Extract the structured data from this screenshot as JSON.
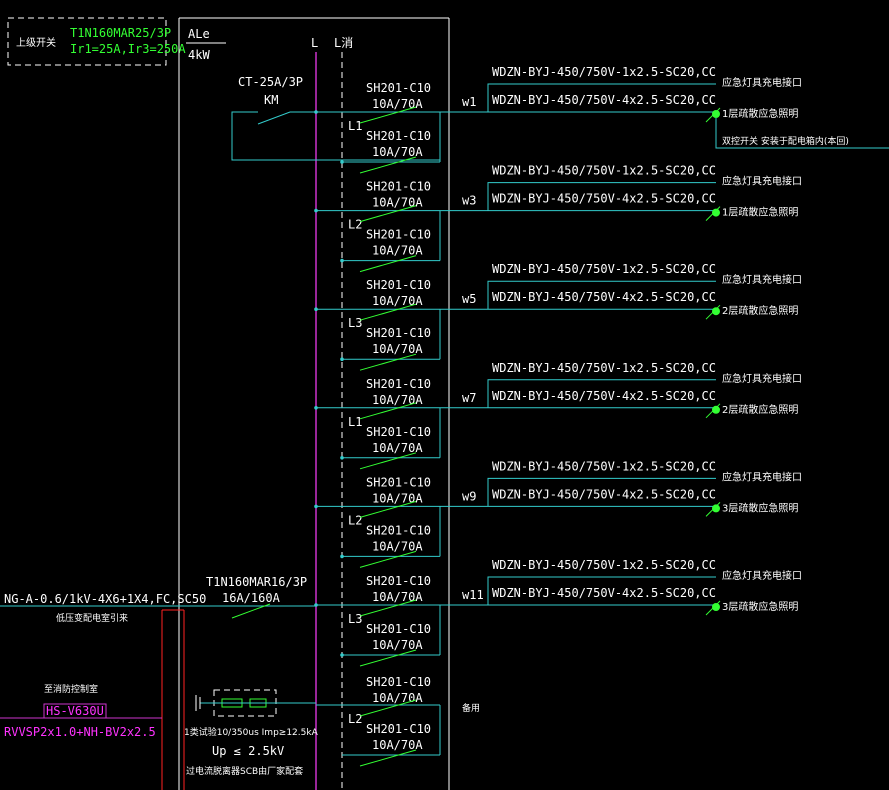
{
  "upstream": {
    "label": "上级开关",
    "breaker_model": "T1N160MAR25/3P",
    "breaker_setting": "Ir1=25A,Ir3=250A"
  },
  "panel": {
    "name": "ALe",
    "power": "4kW",
    "bus_l": "L",
    "bus_fire": "L消"
  },
  "contactor": {
    "model": "CT-25A/3P",
    "tag": "KM"
  },
  "main_breaker": {
    "model": "T1N160MAR16/3P",
    "rating": "16A/160A"
  },
  "incoming": {
    "cable": "NG-A-0.6/1kV-4X6+1X4,FC,SC50",
    "source": "低压变配电室引来"
  },
  "fire_control": {
    "room": "至消防控制室",
    "module": "HS-V630U",
    "cable": "RVVSP2x1.0+NH-BV2x2.5"
  },
  "spd": {
    "spec": "1类试验10/350us Imp≥12.5kA",
    "up": "Up ≤ 2.5kV",
    "note": "过电流脱离器SCB由厂家配套"
  },
  "circuits": [
    {
      "phase": "L1",
      "breaker_a": "SH201-C10",
      "rating_a": "10A/70A",
      "breaker_b": "SH201-C10",
      "rating_b": "10A/70A",
      "id": "w1",
      "cable_a": "WDZN-BYJ-450/750V-1x2.5-SC20,CC",
      "cable_b": "WDZN-BYJ-450/750V-4x2.5-SC20,CC",
      "dest_a": "应急灯具充电接口",
      "dest_b": "1层疏散应急照明",
      "note": "双控开关 安装于配电箱内(本回)"
    },
    {
      "phase": "L2",
      "breaker_a": "SH201-C10",
      "rating_a": "10A/70A",
      "breaker_b": "SH201-C10",
      "rating_b": "10A/70A",
      "id": "w3",
      "cable_a": "WDZN-BYJ-450/750V-1x2.5-SC20,CC",
      "cable_b": "WDZN-BYJ-450/750V-4x2.5-SC20,CC",
      "dest_a": "应急灯具充电接口",
      "dest_b": "1层疏散应急照明",
      "note": ""
    },
    {
      "phase": "L3",
      "breaker_a": "SH201-C10",
      "rating_a": "10A/70A",
      "breaker_b": "SH201-C10",
      "rating_b": "10A/70A",
      "id": "w5",
      "cable_a": "WDZN-BYJ-450/750V-1x2.5-SC20,CC",
      "cable_b": "WDZN-BYJ-450/750V-4x2.5-SC20,CC",
      "dest_a": "应急灯具充电接口",
      "dest_b": "2层疏散应急照明",
      "note": ""
    },
    {
      "phase": "L1",
      "breaker_a": "SH201-C10",
      "rating_a": "10A/70A",
      "breaker_b": "SH201-C10",
      "rating_b": "10A/70A",
      "id": "w7",
      "cable_a": "WDZN-BYJ-450/750V-1x2.5-SC20,CC",
      "cable_b": "WDZN-BYJ-450/750V-4x2.5-SC20,CC",
      "dest_a": "应急灯具充电接口",
      "dest_b": "2层疏散应急照明",
      "note": ""
    },
    {
      "phase": "L2",
      "breaker_a": "SH201-C10",
      "rating_a": "10A/70A",
      "breaker_b": "SH201-C10",
      "rating_b": "10A/70A",
      "id": "w9",
      "cable_a": "WDZN-BYJ-450/750V-1x2.5-SC20,CC",
      "cable_b": "WDZN-BYJ-450/750V-4x2.5-SC20,CC",
      "dest_a": "应急灯具充电接口",
      "dest_b": "3层疏散应急照明",
      "note": ""
    },
    {
      "phase": "L3",
      "breaker_a": "SH201-C10",
      "rating_a": "10A/70A",
      "breaker_b": "SH201-C10",
      "rating_b": "10A/70A",
      "id": "w11",
      "cable_a": "WDZN-BYJ-450/750V-1x2.5-SC20,CC",
      "cable_b": "WDZN-BYJ-450/750V-4x2.5-SC20,CC",
      "dest_a": "应急灯具充电接口",
      "dest_b": "3层疏散应急照明",
      "note": ""
    }
  ],
  "spare": {
    "phase": "L2",
    "breaker_a": "SH201-C10",
    "rating_a": "10A/70A",
    "breaker_b": "SH201-C10",
    "rating_b": "10A/70A",
    "label": "备用"
  },
  "colors": {
    "background": "#000000",
    "line_white": "#ffffff",
    "line_cyan": "#33cccc",
    "line_green": "#33ff33",
    "line_magenta": "#cc33cc",
    "line_red": "#ff2222"
  }
}
